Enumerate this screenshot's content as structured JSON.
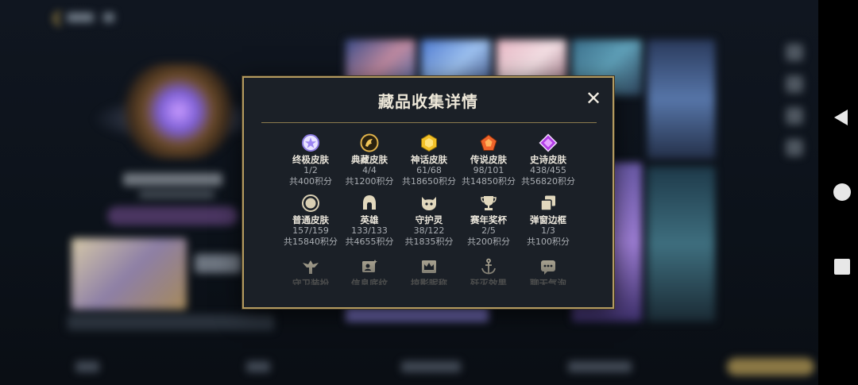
{
  "modal": {
    "title": "藏品收集详情",
    "close_glyph": "✕"
  },
  "items": [
    {
      "name": "终极皮肤",
      "count": "1/2",
      "points": "共400积分",
      "icon": "ultimate-skin-icon",
      "color": "#b7a6ff"
    },
    {
      "name": "典藏皮肤",
      "count": "4/4",
      "points": "共1200积分",
      "icon": "collection-skin-icon",
      "color": "#e0b24a"
    },
    {
      "name": "神话皮肤",
      "count": "61/68",
      "points": "共18650积分",
      "icon": "mythic-skin-icon",
      "color": "#f2c027"
    },
    {
      "name": "传说皮肤",
      "count": "98/101",
      "points": "共14850积分",
      "icon": "legendary-skin-icon",
      "color": "#f0642a"
    },
    {
      "name": "史诗皮肤",
      "count": "438/455",
      "points": "共56820积分",
      "icon": "epic-skin-icon",
      "color": "#b23ee6"
    },
    {
      "name": "普通皮肤",
      "count": "157/159",
      "points": "共15840积分",
      "icon": "normal-skin-icon",
      "color": "#d9cfb3"
    },
    {
      "name": "英雄",
      "count": "133/133",
      "points": "共4655积分",
      "icon": "hero-helmet-icon",
      "color": "#d9cfb3"
    },
    {
      "name": "守护灵",
      "count": "38/122",
      "points": "共1835积分",
      "icon": "guardian-spirit-icon",
      "color": "#d9cfb3"
    },
    {
      "name": "赛年奖杯",
      "count": "2/5",
      "points": "共200积分",
      "icon": "trophy-icon",
      "color": "#d9cfb3"
    },
    {
      "name": "弹窗边框",
      "count": "1/3",
      "points": "共100积分",
      "icon": "popup-frame-icon",
      "color": "#d9cfb3"
    },
    {
      "name": "守卫装扮",
      "icon": "guard-outfit-icon",
      "color": "#d9cfb3"
    },
    {
      "name": "信息底纹",
      "icon": "info-background-icon",
      "color": "#d9cfb3"
    },
    {
      "name": "掠影昵称",
      "icon": "nickname-crown-icon",
      "color": "#d9cfb3"
    },
    {
      "name": "歼灭效果",
      "icon": "anchor-effect-icon",
      "color": "#d9cfb3"
    },
    {
      "name": "聊天气泡",
      "icon": "chat-bubble-icon",
      "color": "#d9cfb3"
    }
  ],
  "colors": {
    "accent_gold": "#b39a5f",
    "modal_bg": "#1b2027",
    "text_primary": "#ece7dc",
    "text_secondary": "#a9adb2"
  }
}
